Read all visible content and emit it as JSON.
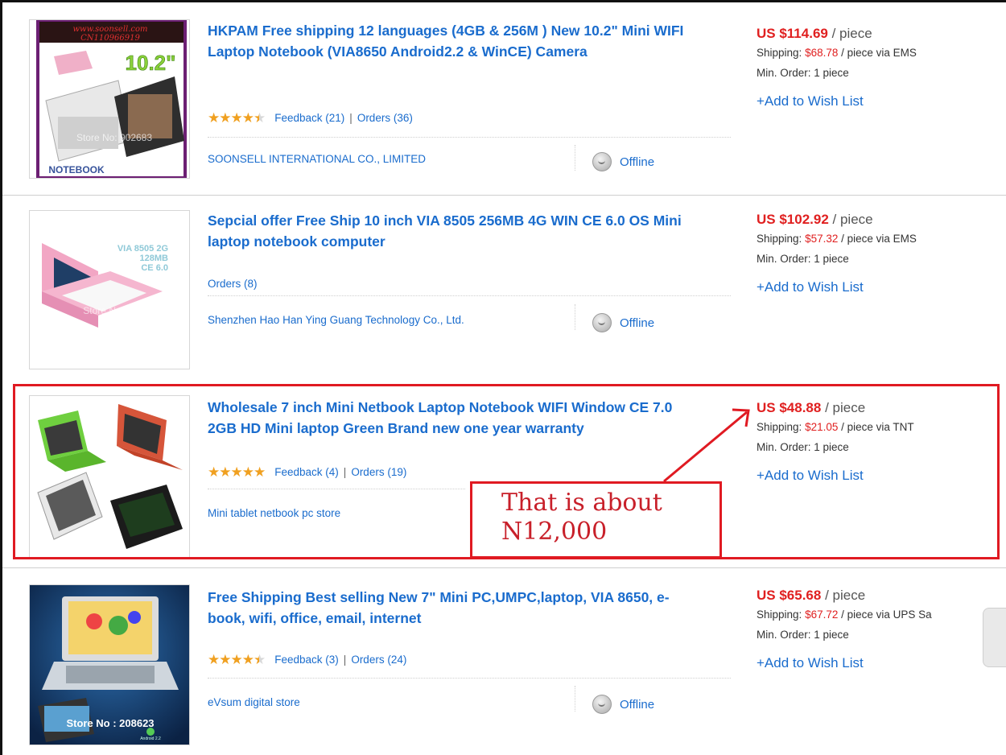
{
  "listings": [
    {
      "title": "HKPAM Free shipping 12 languages (4GB & 256M ) New 10.2\" Mini WIFI Laptop Notebook (VIA8650 Android2.2 & WinCE) Camera",
      "rating": 4.5,
      "feedback": "Feedback (21)",
      "orders": "Orders (36)",
      "store": "SOONSELL INTERNATIONAL CO., LIMITED",
      "status": "Offline",
      "price": "US $114.69",
      "unit": "/ piece",
      "shipping_label": "Shipping:",
      "shipping_amount": "$68.78",
      "shipping_rest": "/ piece via EMS",
      "min_order": "Min. Order: 1 piece",
      "wish": "+Add to Wish List",
      "thumb_text": [
        "www.soonsell.com",
        "CN110966919",
        "10.2\"",
        "Store No: 902683",
        "NOTEBOOK"
      ]
    },
    {
      "title": "Sepcial offer Free Ship 10 inch VIA 8505 256MB 4G WIN CE 6.0 OS Mini laptop notebook computer",
      "orders": "Orders (8)",
      "store": "Shenzhen Hao Han Ying Guang Technology Co., Ltd.",
      "status": "Offline",
      "price": "US $102.92",
      "unit": "/ piece",
      "shipping_label": "Shipping:",
      "shipping_amount": "$57.32",
      "shipping_rest": "/ piece via EMS",
      "min_order": "Min. Order: 1 piece",
      "wish": "+Add to Wish List",
      "thumb_text": [
        "VIA 8505 2G",
        "128MB",
        "CE 6.0",
        "Store No: 75668"
      ]
    },
    {
      "title": "Wholesale 7 inch Mini Netbook Laptop Notebook WIFI Window CE 7.0 2GB HD Mini laptop Green Brand new one year warranty",
      "rating": 5,
      "feedback": "Feedback (4)",
      "orders": "Orders (19)",
      "store": "Mini tablet netbook pc store",
      "price": "US $48.88",
      "unit": "/ piece",
      "shipping_label": "Shipping:",
      "shipping_amount": "$21.05",
      "shipping_rest": "/ piece via TNT",
      "min_order": "Min. Order: 1 piece",
      "wish": "+Add to Wish List"
    },
    {
      "title": "Free Shipping Best selling New 7\" Mini PC,UMPC,laptop, VIA 8650, e-book, wifi, office, email, internet",
      "rating": 4.5,
      "feedback": "Feedback (3)",
      "orders": "Orders (24)",
      "store": "eVsum digital store",
      "status": "Offline",
      "price": "US $65.68",
      "unit": "/ piece",
      "shipping_label": "Shipping:",
      "shipping_amount": "$67.72",
      "shipping_rest": "/ piece via UPS Sa",
      "min_order": "Min. Order: 1 piece",
      "wish": "+Add to Wish List",
      "thumb_text": [
        "Store No : 208623",
        "Android 2.2"
      ]
    }
  ],
  "annotation": {
    "line1": "That is about",
    "line2": "N12,000"
  },
  "colors": {
    "link": "#1a6ccd",
    "price": "#e02020",
    "highlight": "#e01a22",
    "star": "#f0a020"
  },
  "icons": {
    "status": "chat-bubble-icon",
    "star": "star-icon"
  }
}
